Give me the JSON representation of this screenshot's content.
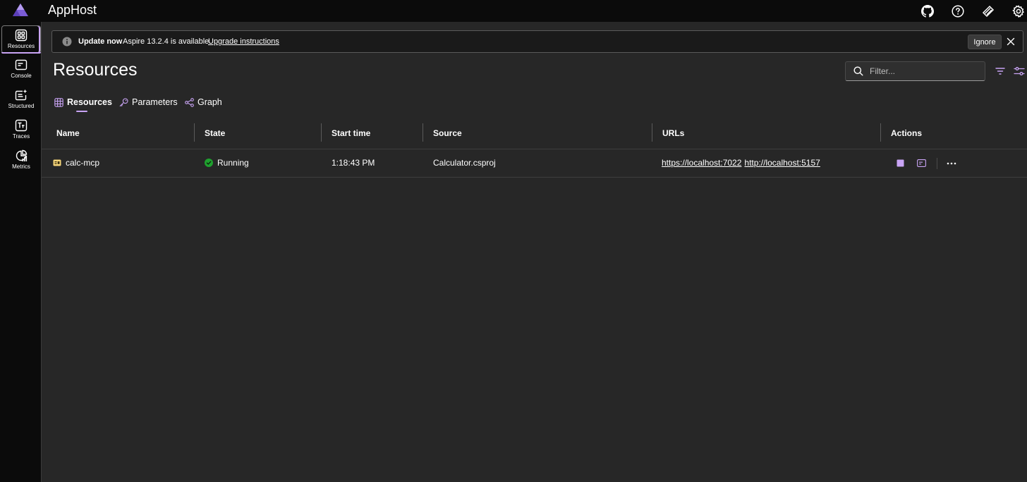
{
  "app": {
    "title": "AppHost"
  },
  "sidebar": {
    "items": [
      {
        "label": "Resources",
        "icon": "grid-icon",
        "active": true
      },
      {
        "label": "Console",
        "icon": "console-icon"
      },
      {
        "label": "Structured",
        "icon": "structured-logs-icon"
      },
      {
        "label": "Traces",
        "icon": "traces-icon"
      },
      {
        "label": "Metrics",
        "icon": "metrics-icon"
      }
    ]
  },
  "banner": {
    "title": "Update now",
    "message": "Aspire 13.2.4 is available.",
    "link": "Upgrade instructions",
    "ignore_label": "Ignore"
  },
  "page": {
    "title": "Resources"
  },
  "filter": {
    "placeholder": "Filter..."
  },
  "tabs": [
    {
      "label": "Resources",
      "active": true
    },
    {
      "label": "Parameters"
    },
    {
      "label": "Graph"
    }
  ],
  "table": {
    "columns": [
      "Name",
      "State",
      "Start time",
      "Source",
      "URLs",
      "Actions"
    ],
    "rows": [
      {
        "name": "calc-mcp",
        "state": "Running",
        "start_time": "1:18:43 PM",
        "source": "Calculator.csproj",
        "urls": [
          "https://localhost:7022",
          "http://localhost:5157"
        ]
      }
    ]
  },
  "colors": {
    "accent": "#c9a4f5",
    "running": "#1fa12e",
    "background": "#272727",
    "chrome": "#0b0b0b"
  }
}
